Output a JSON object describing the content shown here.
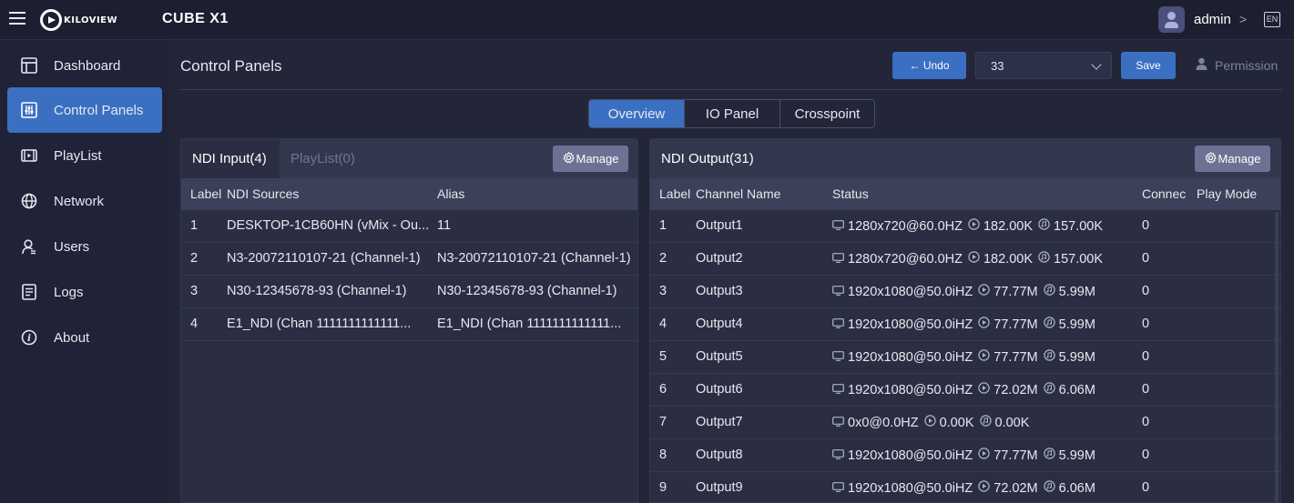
{
  "topbar": {
    "logo": "KILOVIEW",
    "product": "CUBE X1",
    "user": "admin",
    "lang": "EN"
  },
  "sidebar": {
    "items": [
      {
        "label": "Dashboard",
        "icon": "dashboard-icon"
      },
      {
        "label": "Control Panels",
        "icon": "control-panels-icon",
        "active": true
      },
      {
        "label": "PlayList",
        "icon": "playlist-icon"
      },
      {
        "label": "Network",
        "icon": "globe-icon"
      },
      {
        "label": "Users",
        "icon": "users-icon"
      },
      {
        "label": "Logs",
        "icon": "logs-icon"
      },
      {
        "label": "About",
        "icon": "info-icon"
      }
    ]
  },
  "header": {
    "title": "Control Panels",
    "undo_label": "← Undo",
    "select_value": "33",
    "save_label": "Save",
    "permission_label": "Permission"
  },
  "tabs": [
    {
      "label": "Overview",
      "active": true
    },
    {
      "label": "IO Panel"
    },
    {
      "label": "Crosspoint"
    }
  ],
  "input_panel": {
    "tab_active": "NDI Input(4)",
    "tab_inactive": "PlayList(0)",
    "manage_label": "Manage",
    "columns": [
      "Label",
      "NDI Sources",
      "Alias"
    ],
    "rows": [
      [
        "1",
        "DESKTOP-1CB60HN (vMix - Ou...",
        "11"
      ],
      [
        "2",
        "N3-20072110107-21 (Channel-1)",
        "N3-20072110107-21 (Channel-1)"
      ],
      [
        "3",
        "N30-12345678-93 (Channel-1)",
        "N30-12345678-93 (Channel-1)"
      ],
      [
        "4",
        "E1_NDI (Chan 1111111111111...",
        "E1_NDI (Chan 1111111111111..."
      ]
    ]
  },
  "output_panel": {
    "title": "NDI Output(31)",
    "manage_label": "Manage",
    "columns": [
      "Label",
      "Channel Name",
      "Status",
      "Connec",
      "Play Mode"
    ],
    "rows": [
      {
        "label": "1",
        "name": "Output1",
        "res": "1280x720@60.0HZ",
        "rate1": "182.00K",
        "rate2": "157.00K",
        "conn": "0"
      },
      {
        "label": "2",
        "name": "Output2",
        "res": "1280x720@60.0HZ",
        "rate1": "182.00K",
        "rate2": "157.00K",
        "conn": "0"
      },
      {
        "label": "3",
        "name": "Output3",
        "res": "1920x1080@50.0iHZ",
        "rate1": "77.77M",
        "rate2": "5.99M",
        "conn": "0"
      },
      {
        "label": "4",
        "name": "Output4",
        "res": "1920x1080@50.0iHZ",
        "rate1": "77.77M",
        "rate2": "5.99M",
        "conn": "0"
      },
      {
        "label": "5",
        "name": "Output5",
        "res": "1920x1080@50.0iHZ",
        "rate1": "77.77M",
        "rate2": "5.99M",
        "conn": "0"
      },
      {
        "label": "6",
        "name": "Output6",
        "res": "1920x1080@50.0iHZ",
        "rate1": "72.02M",
        "rate2": "6.06M",
        "conn": "0"
      },
      {
        "label": "7",
        "name": "Output7",
        "res": "0x0@0.0HZ",
        "rate1": "0.00K",
        "rate2": "0.00K",
        "conn": "0"
      },
      {
        "label": "8",
        "name": "Output8",
        "res": "1920x1080@50.0iHZ",
        "rate1": "77.77M",
        "rate2": "5.99M",
        "conn": "0"
      },
      {
        "label": "9",
        "name": "Output9",
        "res": "1920x1080@50.0iHZ",
        "rate1": "72.02M",
        "rate2": "6.06M",
        "conn": "0"
      }
    ]
  },
  "colors": {
    "accent": "#3b6fc2",
    "background": "#232639",
    "panel": "#2b2e42",
    "table_header": "#3c4058"
  }
}
